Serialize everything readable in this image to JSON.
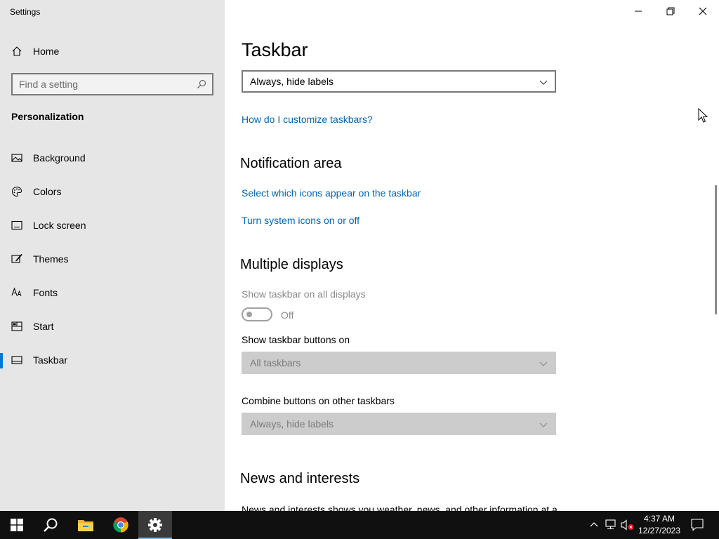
{
  "window": {
    "title": "Settings"
  },
  "sidebar": {
    "home_label": "Home",
    "search_placeholder": "Find a setting",
    "section": "Personalization",
    "items": [
      {
        "label": "Background",
        "icon": "image-icon"
      },
      {
        "label": "Colors",
        "icon": "palette-icon"
      },
      {
        "label": "Lock screen",
        "icon": "lock-screen-icon"
      },
      {
        "label": "Themes",
        "icon": "brush-icon"
      },
      {
        "label": "Fonts",
        "icon": "font-icon"
      },
      {
        "label": "Start",
        "icon": "start-icon"
      },
      {
        "label": "Taskbar",
        "icon": "taskbar-icon",
        "selected": true
      }
    ]
  },
  "main": {
    "title": "Taskbar",
    "combine_dropdown_value": "Always, hide labels",
    "customize_link": "How do I customize taskbars?",
    "notification_area": {
      "heading": "Notification area",
      "link_icons": "Select which icons appear on the taskbar",
      "link_system": "Turn system icons on or off"
    },
    "multiple_displays": {
      "heading": "Multiple displays",
      "show_all_label": "Show taskbar on all displays",
      "toggle_state": "Off",
      "buttons_on_label": "Show taskbar buttons on",
      "buttons_on_value": "All taskbars",
      "combine_other_label": "Combine buttons on other taskbars",
      "combine_other_value": "Always, hide labels"
    },
    "news": {
      "heading": "News and interests",
      "text": "News and interests shows you weather, news, and other information at a"
    }
  },
  "taskbar": {
    "apps": [
      "start-icon",
      "search-icon",
      "file-explorer-icon",
      "chrome-icon",
      "settings-icon"
    ],
    "time": "4:37 AM",
    "date": "12/27/2023"
  },
  "colors": {
    "accent": "#0078d7",
    "link": "#0066b4",
    "sidebar_bg": "#e6e6e6",
    "taskbar_bg": "#101010"
  }
}
